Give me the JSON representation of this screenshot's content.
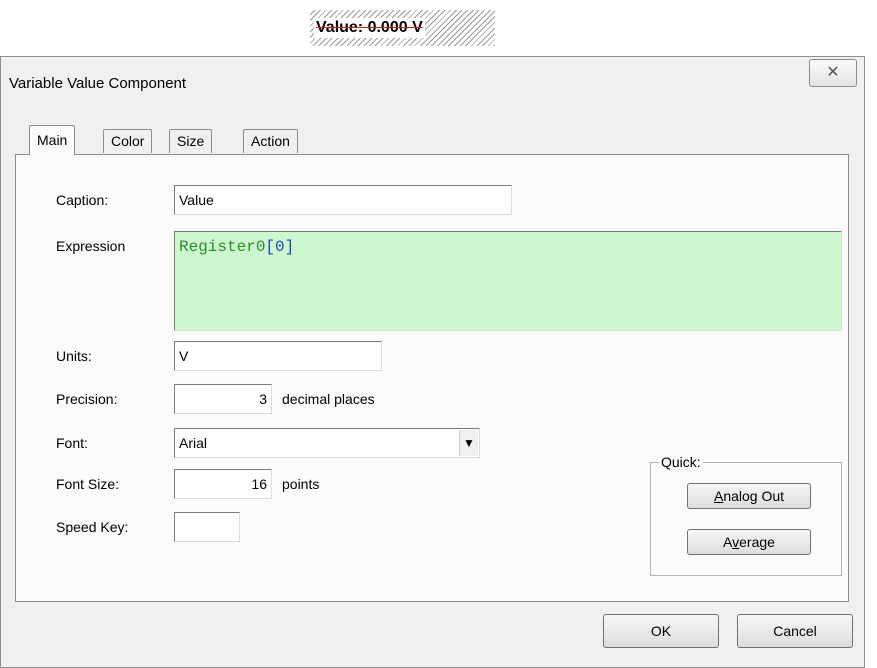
{
  "preview": {
    "text": "Value: 0.000 V"
  },
  "dialog": {
    "title": "Variable Value Component",
    "close_glyph": "✕"
  },
  "tabs": [
    {
      "label": "Main",
      "active": true
    },
    {
      "label": "Color",
      "active": false
    },
    {
      "label": "Size",
      "active": false
    },
    {
      "label": "Action",
      "active": false
    }
  ],
  "form": {
    "caption_label": "Caption:",
    "caption_value": "Value",
    "expression_label": "Expression",
    "expression_ident": "Register0",
    "expression_index": "[0]",
    "units_label": "Units:",
    "units_value": "V",
    "precision_label": "Precision:",
    "precision_value": "3",
    "precision_suffix": "decimal places",
    "font_label": "Font:",
    "font_value": "Arial",
    "font_size_label": "Font Size:",
    "font_size_value": "16",
    "font_size_suffix": "points",
    "speed_key_label": "Speed Key:",
    "speed_key_value": ""
  },
  "quick": {
    "label": "Quick:",
    "analog_out": {
      "first": "A",
      "rest": "nalog Out"
    },
    "average": {
      "first": "A",
      "underlined": "v",
      "rest": "erage"
    }
  },
  "buttons": {
    "ok": "OK",
    "cancel": "Cancel"
  },
  "colors": {
    "expression_bg": "#cdf7cd",
    "expression_ident": "#2e8b2e",
    "expression_index": "#2046c8",
    "strike": "#d41d1d"
  }
}
